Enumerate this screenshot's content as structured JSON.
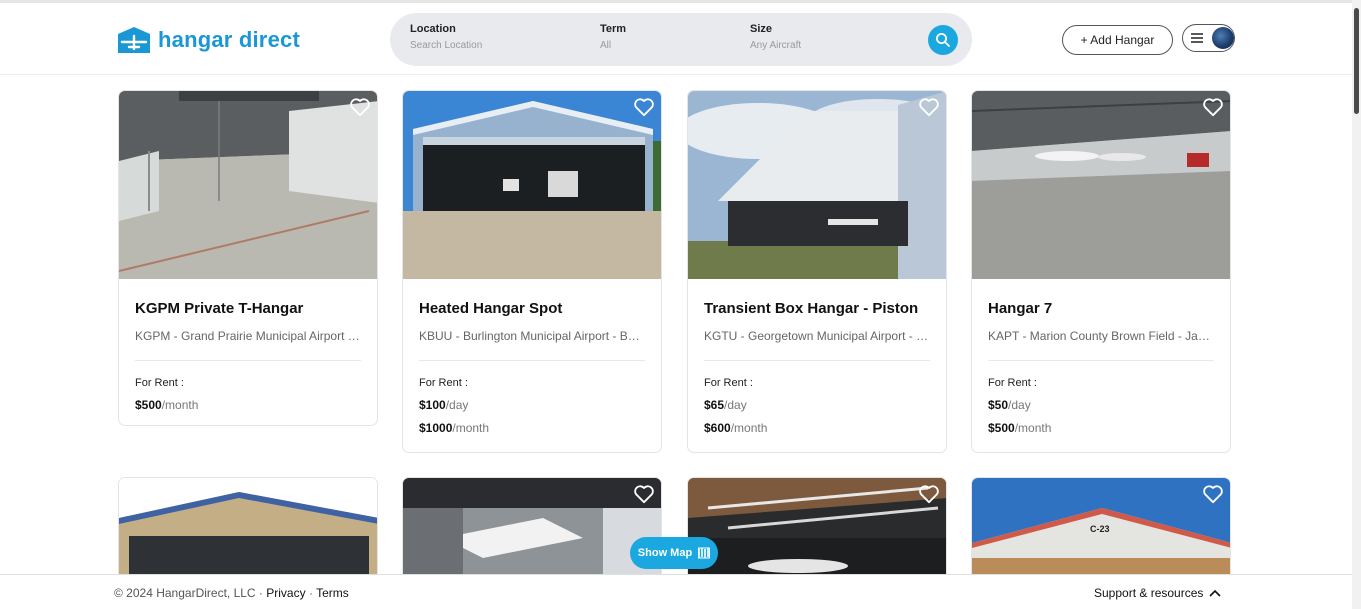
{
  "brand": {
    "name": "hangar direct",
    "color": "#1a98d5"
  },
  "search": {
    "location_label": "Location",
    "location_placeholder": "Search Location",
    "term_label": "Term",
    "term_value": "All",
    "size_label": "Size",
    "size_value": "Any Aircraft",
    "icon": "search-icon"
  },
  "nav": {
    "add_hangar": "+ Add Hangar",
    "menu_icon": "hamburger-icon"
  },
  "listings": [
    {
      "title": "KGPM Private T-Hangar",
      "location": "KGPM - Grand Prairie Municipal Airport - Grand Prairie, TX",
      "rent_label": "For Rent :",
      "prices": [
        {
          "amount": "$500",
          "unit": "/month"
        }
      ]
    },
    {
      "title": "Heated Hangar Spot",
      "location": "KBUU - Burlington Municipal Airport - Burlington, WI",
      "rent_label": "For Rent :",
      "prices": [
        {
          "amount": "$100",
          "unit": "/day"
        },
        {
          "amount": "$1000",
          "unit": "/month"
        }
      ]
    },
    {
      "title": "Transient Box Hangar - Piston",
      "location": "KGTU - Georgetown Municipal Airport - Georgetown, TX",
      "rent_label": "For Rent :",
      "prices": [
        {
          "amount": "$65",
          "unit": "/day"
        },
        {
          "amount": "$600",
          "unit": "/month"
        }
      ]
    },
    {
      "title": "Hangar 7",
      "location": "KAPT - Marion County Brown Field - Jasper, TN",
      "rent_label": "For Rent :",
      "prices": [
        {
          "amount": "$50",
          "unit": "/day"
        },
        {
          "amount": "$500",
          "unit": "/month"
        }
      ]
    }
  ],
  "lower_photos": [
    {
      "sign": ""
    },
    {
      "sign": ""
    },
    {
      "sign": ""
    },
    {
      "sign": "C-23"
    }
  ],
  "show_map": "Show Map",
  "footer": {
    "copyright": "© 2024 HangarDirect, LLC",
    "sep1": " · ",
    "privacy": "Privacy",
    "sep2": " · ",
    "terms": "Terms",
    "support": "Support & resources"
  },
  "colors": {
    "accent": "#1ba8e0",
    "text": "#222222",
    "muted": "#666666"
  }
}
